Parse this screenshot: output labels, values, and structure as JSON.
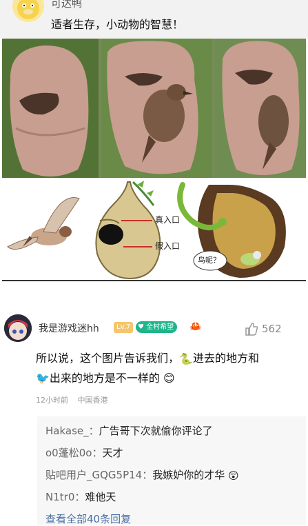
{
  "post": {
    "author": "可达鸭",
    "title": "适者生存，小动物的智慧！"
  },
  "comic": {
    "label_real_entrance": "真入口",
    "label_fake_entrance": "假入口",
    "snake_speech": "鸟呢？"
  },
  "comment": {
    "username": "我是游戏迷hh",
    "level_badge": "Lv.7",
    "fan_badge": "全村希望",
    "like_count": "562",
    "text_part1": "所以说，这个图片告诉我们，",
    "text_part2": "进去的地方和",
    "text_part3": "出来的地方是不一样的",
    "time": "12小时前",
    "location": "中国香港"
  },
  "replies": {
    "items": [
      {
        "name": "Hakase_：",
        "text": "广告哥下次就偷你评论了"
      },
      {
        "name": "o0蓬松0o：",
        "text": "天才"
      },
      {
        "name": "贴吧用户_GQG5P14：",
        "text": "我嫉妒你的才华"
      },
      {
        "name": "N1tr0：",
        "text": "难他天"
      }
    ],
    "more_label": "查看全部40条回复"
  },
  "colors": {
    "accent_link": "#4a6fa5",
    "level_badge": "#f5c66e",
    "fan_badge": "#1fb58a"
  }
}
